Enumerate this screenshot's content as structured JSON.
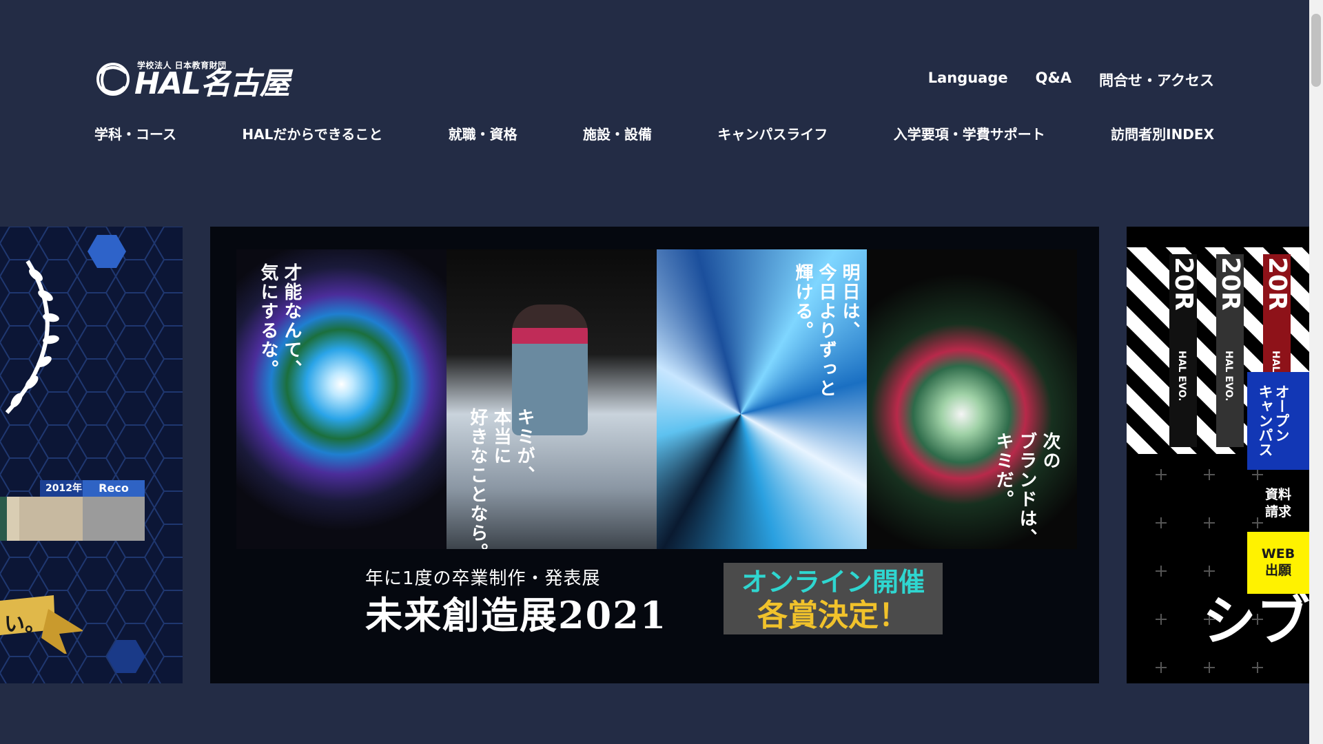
{
  "brand": {
    "subtitle": "学校法人 日本教育財団",
    "name": "HAL名古屋"
  },
  "utility_nav": [
    "Language",
    "Q&A",
    "問合せ・アクセス"
  ],
  "main_nav": [
    "学科・コース",
    "HALだからできること",
    "就職・資格",
    "施設・設備",
    "キャンパスライフ",
    "入学要項・学費サポート",
    "訪問者別INDEX"
  ],
  "carousel": {
    "left_slide": {
      "year": "2012年",
      "reco": "Reco",
      "ribbon": "い。"
    },
    "center_slide": {
      "posters": [
        {
          "text": "才能なんて、\n気にするな。"
        },
        {
          "text": "キミが、\n本当に\n好きなことなら。"
        },
        {
          "text": "明日は、\n今日よりずっと\n輝ける。"
        },
        {
          "text": "次の\nブランドは、\nキミだ。"
        }
      ],
      "sub_headline": "年に1度の卒業制作・発表展",
      "headline": "未来創造展2021",
      "badge_line1": "オンライン開催",
      "badge_line2": "各賞決定！"
    },
    "right_slide": {
      "flags": [
        {
          "big": "20R",
          "small": "HAL EVO."
        },
        {
          "big": "20R",
          "small": "HAL EVO."
        },
        {
          "big": "20R",
          "small": "HAL"
        }
      ],
      "headline": "シブ"
    }
  },
  "side_buttons": {
    "open_campus": "オープン\nキャンパス",
    "document_request": "資料\n請求",
    "web_application": "WEB\n出願"
  },
  "colors": {
    "background": "#232c45",
    "open_campus": "#1237b5",
    "web_application": "#fff200",
    "badge_cyan": "#2fd6d0",
    "badge_gold": "#f1c22b"
  }
}
